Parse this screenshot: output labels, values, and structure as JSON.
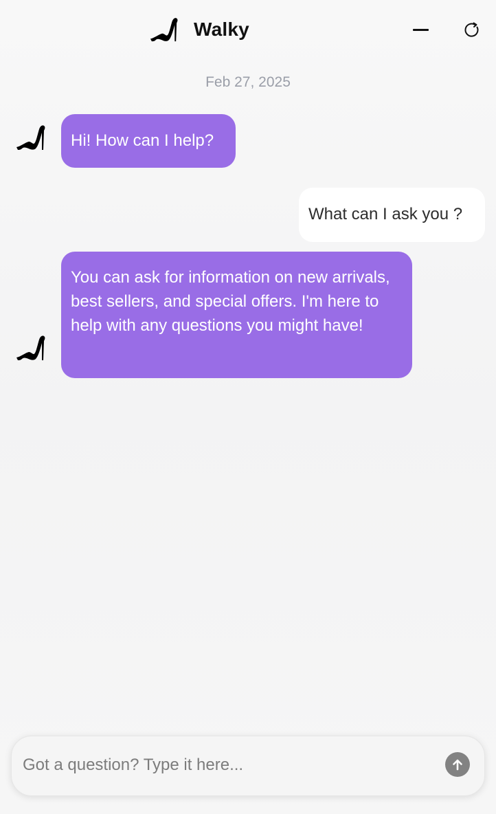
{
  "header": {
    "logo_icon": "high-heel-shoe-icon",
    "title": "Walky",
    "minimize_icon": "minimize-icon",
    "refresh_icon": "refresh-icon"
  },
  "conversation": {
    "date": "Feb 27, 2025",
    "messages": [
      {
        "sender": "bot",
        "avatar_icon": "high-heel-shoe-icon",
        "text": "Hi! How can I help?"
      },
      {
        "sender": "user",
        "text": "What can I ask you ?"
      },
      {
        "sender": "bot",
        "avatar_icon": "high-heel-shoe-icon",
        "text": "You can ask for information on new arrivals, best sellers, and special offers. I'm here to help with any questions you might have!"
      }
    ]
  },
  "composer": {
    "placeholder": "Got a question? Type it here...",
    "value": "",
    "send_icon": "arrow-up-icon"
  },
  "colors": {
    "bot_bubble": "#996de6",
    "user_bubble": "#ffffff",
    "send_button": "#828282",
    "date_text": "#9a9ea8"
  }
}
